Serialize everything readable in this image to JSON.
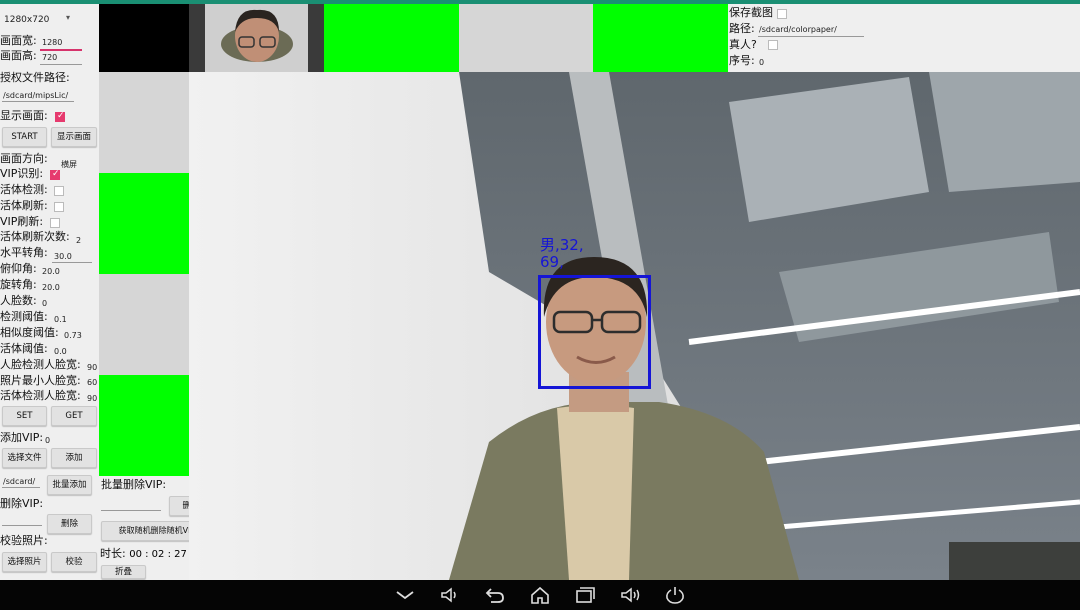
{
  "resolution_select": "1280x720",
  "settings": {
    "width_label": "画面宽:",
    "width_value": "1280",
    "height_label": "画面高:",
    "height_value": "720",
    "license_path_label": "授权文件路径:",
    "license_path_value": "/sdcard/mipsLic/",
    "show_frame_label": "显示画面:",
    "show_frame_checked": true,
    "start_button": "START",
    "show_frame_button": "显示画面",
    "orientation_label": "画面方向:",
    "orientation_value": "横屏",
    "vip_recognize_label": "VIP识别:",
    "vip_recognize_checked": true,
    "liveness_detect_label": "活体检测:",
    "liveness_refresh_label": "活体刷新:",
    "vip_refresh_label": "VIP刷新:",
    "liveness_refresh_count_label": "活体刷新次数:",
    "liveness_refresh_count_value": "2",
    "yaw_label": "水平转角:",
    "yaw_value": "30.0",
    "pitch_label": "俯仰角:",
    "pitch_value": "20.0",
    "roll_label": "旋转角:",
    "roll_value": "20.0",
    "face_count_label": "人脸数:",
    "face_count_value": "0",
    "detect_threshold_label": "检测阈值:",
    "detect_threshold_value": "0.1",
    "similarity_threshold_label": "相似度阈值:",
    "similarity_threshold_value": "0.73",
    "liveness_threshold_label": "活体阈值:",
    "liveness_threshold_value": "0.0",
    "face_detect_width_label": "人脸检测人脸宽:",
    "face_detect_width_value": "90",
    "photo_min_face_label": "照片最小人脸宽:",
    "photo_min_face_value": "60",
    "liveness_face_width_label": "活体检测人脸宽:",
    "liveness_face_width_value": "90",
    "set_button": "SET",
    "get_button": "GET",
    "add_vip_label": "添加VIP:",
    "add_vip_value": "0",
    "choose_file_button": "选择文件",
    "add_button": "添加",
    "sdcard_value": "/sdcard/",
    "batch_add_button": "批量添加",
    "delete_vip_label": "删除VIP:",
    "delete_button": "删除",
    "verify_photo_label": "校验照片:",
    "choose_photo_button": "选择照片",
    "verify_button": "校验"
  },
  "middle": {
    "batch_delete_label": "批量删除VIP:",
    "batch_delete_button": "删除",
    "random_button": "获取随机删除随机VIP",
    "duration_label": "时长:",
    "duration_value": "00 : 02 : 27",
    "partial_button": "折叠"
  },
  "top_right": {
    "save_screenshot_label": "保存截图",
    "path_label": "路径:",
    "path_value": "/sdcard/colorpaper/",
    "real_person_label": "真人?",
    "index_label": "序号:",
    "index_value": "0"
  },
  "face_overlay": {
    "line1": "男,32,",
    "line2": "69,",
    "box_color": "#1515d6"
  },
  "colors": {
    "green": "#00ff00",
    "gray": "#d6d6d6",
    "accent": "#e63a6e",
    "topstrip": "#1a8f73"
  },
  "navbar": {
    "icons": [
      "chevron-down-icon",
      "volume-down-icon",
      "back-icon",
      "home-icon",
      "recent-apps-icon",
      "volume-up-icon",
      "power-icon"
    ]
  }
}
